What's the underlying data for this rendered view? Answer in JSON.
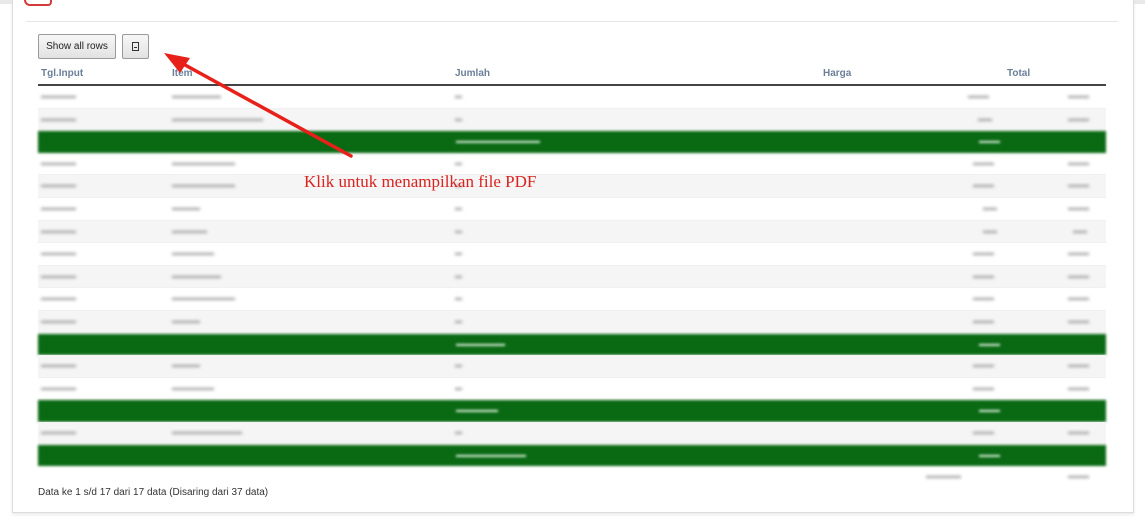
{
  "toolbar": {
    "show_all_label": "Show all rows",
    "pdf_icon": "pdf-file-icon"
  },
  "table": {
    "headers": [
      "Tgl.Input",
      "Item",
      "Jumlah",
      "Harga",
      "Total"
    ]
  },
  "footer": {
    "info": "Data ke 1 s/d 17 dari 17 data (Disaring dari 37 data)"
  },
  "annotation": {
    "text": "Klik untuk menampilkan file PDF",
    "color": "#d8231f"
  },
  "colors": {
    "subtotal_row": "#0a6a14",
    "header_text": "#6b7f99"
  }
}
